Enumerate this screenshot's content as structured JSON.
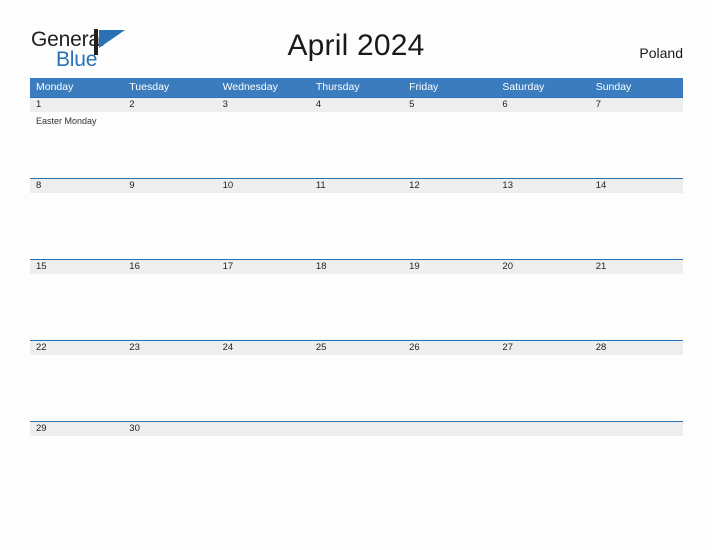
{
  "brand": {
    "name_part1": "General",
    "name_part2": "Blue",
    "mark_icon": "triangle-flag-icon"
  },
  "header": {
    "title": "April 2024",
    "country": "Poland"
  },
  "colors": {
    "header_blue": "#3a7cbe",
    "rule_blue": "#2a72b5",
    "date_band_gray": "#eeeeee",
    "logo_blue": "#2a72b5",
    "page_background": "#fdfdfd"
  },
  "calendar": {
    "weekdays": [
      "Monday",
      "Tuesday",
      "Wednesday",
      "Thursday",
      "Friday",
      "Saturday",
      "Sunday"
    ],
    "weeks": [
      {
        "dates": [
          "1",
          "2",
          "3",
          "4",
          "5",
          "6",
          "7"
        ],
        "events": [
          [
            "Easter Monday"
          ],
          [],
          [],
          [],
          [],
          [],
          []
        ]
      },
      {
        "dates": [
          "8",
          "9",
          "10",
          "11",
          "12",
          "13",
          "14"
        ],
        "events": [
          [],
          [],
          [],
          [],
          [],
          [],
          []
        ]
      },
      {
        "dates": [
          "15",
          "16",
          "17",
          "18",
          "19",
          "20",
          "21"
        ],
        "events": [
          [],
          [],
          [],
          [],
          [],
          [],
          []
        ]
      },
      {
        "dates": [
          "22",
          "23",
          "24",
          "25",
          "26",
          "27",
          "28"
        ],
        "events": [
          [],
          [],
          [],
          [],
          [],
          [],
          []
        ]
      },
      {
        "dates": [
          "29",
          "30",
          "",
          "",
          "",
          "",
          ""
        ],
        "events": [
          [],
          [],
          [],
          [],
          [],
          [],
          []
        ]
      }
    ]
  }
}
